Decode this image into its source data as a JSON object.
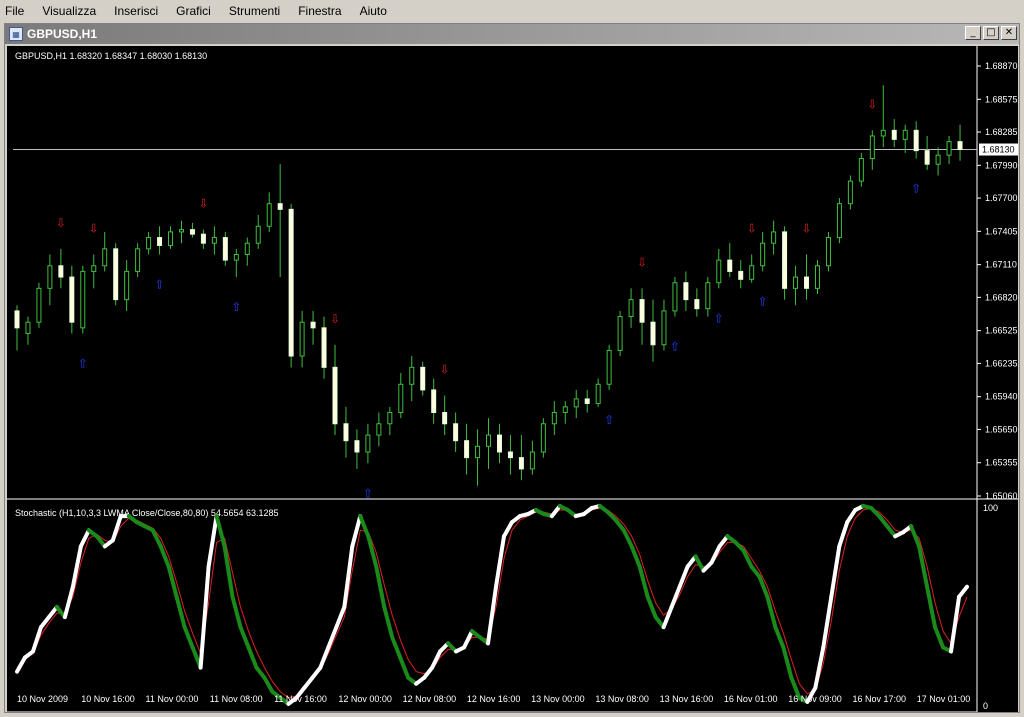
{
  "menu": [
    "File",
    "Visualizza",
    "Inserisci",
    "Grafici",
    "Strumenti",
    "Finestra",
    "Aiuto"
  ],
  "window": {
    "title": "GBPUSD,H1",
    "minimize": "_",
    "maximize": "□",
    "close": "✕"
  },
  "main_chart": {
    "header": "GBPUSD,H1  1.68320 1.68347 1.68030 1.68130",
    "price_levels": [
      "1.68870",
      "1.68575",
      "1.68285",
      "1.67990",
      "1.67700",
      "1.67405",
      "1.67110",
      "1.66820",
      "1.66525",
      "1.66235",
      "1.65940",
      "1.65650",
      "1.65355",
      "1.65060"
    ],
    "current_price": "1.68130"
  },
  "stoch_chart": {
    "header": "Stochastic (H1,10,3,3 LWMA Close/Close,80,80) 54.5654 63.1285",
    "levels": [
      "100",
      "0"
    ]
  },
  "time_labels": [
    "10 Nov 2009",
    "10 Nov 16:00",
    "11 Nov 00:00",
    "11 Nov 08:00",
    "11 Nov 16:00",
    "12 Nov 00:00",
    "12 Nov 08:00",
    "12 Nov 16:00",
    "13 Nov 00:00",
    "13 Nov 08:00",
    "13 Nov 16:00",
    "16 Nov 01:00",
    "16 Nov 09:00",
    "16 Nov 17:00",
    "17 Nov 01:00"
  ],
  "chart_data": [
    {
      "type": "candlestick",
      "title": "GBPUSD,H1",
      "ylim": [
        1.6506,
        1.6887
      ],
      "current_price": 1.6813,
      "candles": [
        [
          1.667,
          1.6675,
          1.6635,
          1.6655
        ],
        [
          1.665,
          1.6665,
          1.664,
          1.666
        ],
        [
          1.666,
          1.6695,
          1.6655,
          1.669
        ],
        [
          1.669,
          1.672,
          1.6675,
          1.671
        ],
        [
          1.671,
          1.6725,
          1.669,
          1.67
        ],
        [
          1.67,
          1.671,
          1.665,
          1.666
        ],
        [
          1.6655,
          1.671,
          1.665,
          1.6705
        ],
        [
          1.6705,
          1.672,
          1.669,
          1.671
        ],
        [
          1.671,
          1.674,
          1.6705,
          1.6725
        ],
        [
          1.6725,
          1.673,
          1.6675,
          1.668
        ],
        [
          1.668,
          1.6715,
          1.667,
          1.6705
        ],
        [
          1.6705,
          1.673,
          1.67,
          1.6725
        ],
        [
          1.6725,
          1.674,
          1.672,
          1.6735
        ],
        [
          1.6735,
          1.6745,
          1.672,
          1.6728
        ],
        [
          1.6728,
          1.6745,
          1.6725,
          1.674
        ],
        [
          1.674,
          1.675,
          1.673,
          1.6742
        ],
        [
          1.6742,
          1.6748,
          1.6735,
          1.6738
        ],
        [
          1.6738,
          1.6742,
          1.6725,
          1.673
        ],
        [
          1.673,
          1.6745,
          1.672,
          1.6735
        ],
        [
          1.6735,
          1.674,
          1.671,
          1.6715
        ],
        [
          1.6715,
          1.6725,
          1.67,
          1.672
        ],
        [
          1.672,
          1.6735,
          1.671,
          1.673
        ],
        [
          1.673,
          1.6755,
          1.6725,
          1.6745
        ],
        [
          1.6745,
          1.6775,
          1.674,
          1.6765
        ],
        [
          1.6765,
          1.68,
          1.67,
          1.676
        ],
        [
          1.676,
          1.6765,
          1.662,
          1.663
        ],
        [
          1.663,
          1.667,
          1.662,
          1.666
        ],
        [
          1.666,
          1.667,
          1.664,
          1.6655
        ],
        [
          1.6655,
          1.6665,
          1.661,
          1.662
        ],
        [
          1.662,
          1.664,
          1.656,
          1.657
        ],
        [
          1.657,
          1.6585,
          1.654,
          1.6555
        ],
        [
          1.6555,
          1.6565,
          1.653,
          1.6545
        ],
        [
          1.6545,
          1.657,
          1.6535,
          1.656
        ],
        [
          1.656,
          1.658,
          1.655,
          1.657
        ],
        [
          1.657,
          1.6585,
          1.656,
          1.658
        ],
        [
          1.658,
          1.6615,
          1.6575,
          1.6605
        ],
        [
          1.6605,
          1.663,
          1.659,
          1.662
        ],
        [
          1.662,
          1.6625,
          1.6595,
          1.66
        ],
        [
          1.66,
          1.661,
          1.657,
          1.658
        ],
        [
          1.658,
          1.6595,
          1.656,
          1.657
        ],
        [
          1.657,
          1.658,
          1.6545,
          1.6555
        ],
        [
          1.6555,
          1.657,
          1.6525,
          1.654
        ],
        [
          1.654,
          1.6565,
          1.6515,
          1.655
        ],
        [
          1.655,
          1.6575,
          1.653,
          1.656
        ],
        [
          1.656,
          1.657,
          1.6535,
          1.6545
        ],
        [
          1.6545,
          1.656,
          1.6525,
          1.654
        ],
        [
          1.654,
          1.656,
          1.652,
          1.653
        ],
        [
          1.653,
          1.6555,
          1.6525,
          1.6545
        ],
        [
          1.6545,
          1.6575,
          1.654,
          1.657
        ],
        [
          1.657,
          1.659,
          1.656,
          1.658
        ],
        [
          1.658,
          1.659,
          1.657,
          1.6585
        ],
        [
          1.6585,
          1.66,
          1.6575,
          1.6592
        ],
        [
          1.6592,
          1.66,
          1.658,
          1.6588
        ],
        [
          1.6588,
          1.661,
          1.6585,
          1.6605
        ],
        [
          1.6605,
          1.664,
          1.66,
          1.6635
        ],
        [
          1.6635,
          1.667,
          1.663,
          1.6665
        ],
        [
          1.6665,
          1.669,
          1.6655,
          1.668
        ],
        [
          1.668,
          1.669,
          1.664,
          1.666
        ],
        [
          1.666,
          1.668,
          1.6625,
          1.664
        ],
        [
          1.664,
          1.668,
          1.6635,
          1.667
        ],
        [
          1.667,
          1.67,
          1.6665,
          1.6695
        ],
        [
          1.6695,
          1.6705,
          1.667,
          1.668
        ],
        [
          1.668,
          1.669,
          1.6665,
          1.6672
        ],
        [
          1.6672,
          1.67,
          1.6665,
          1.6695
        ],
        [
          1.6695,
          1.6725,
          1.669,
          1.6715
        ],
        [
          1.6715,
          1.673,
          1.67,
          1.6705
        ],
        [
          1.6705,
          1.6715,
          1.669,
          1.6698
        ],
        [
          1.6698,
          1.672,
          1.6695,
          1.671
        ],
        [
          1.671,
          1.674,
          1.6705,
          1.673
        ],
        [
          1.673,
          1.675,
          1.672,
          1.674
        ],
        [
          1.674,
          1.6745,
          1.668,
          1.669
        ],
        [
          1.669,
          1.671,
          1.6675,
          1.67
        ],
        [
          1.67,
          1.672,
          1.668,
          1.669
        ],
        [
          1.669,
          1.6715,
          1.6685,
          1.671
        ],
        [
          1.671,
          1.674,
          1.6705,
          1.6735
        ],
        [
          1.6735,
          1.677,
          1.673,
          1.6765
        ],
        [
          1.6765,
          1.679,
          1.676,
          1.6785
        ],
        [
          1.6785,
          1.681,
          1.678,
          1.6805
        ],
        [
          1.6805,
          1.683,
          1.6795,
          1.6825
        ],
        [
          1.6825,
          1.687,
          1.6815,
          1.683
        ],
        [
          1.683,
          1.684,
          1.6815,
          1.6822
        ],
        [
          1.6822,
          1.6835,
          1.681,
          1.683
        ],
        [
          1.683,
          1.6838,
          1.6805,
          1.6812
        ],
        [
          1.6812,
          1.6825,
          1.6795,
          1.68
        ],
        [
          1.68,
          1.6815,
          1.679,
          1.6808
        ],
        [
          1.6808,
          1.6825,
          1.68,
          1.682
        ],
        [
          1.682,
          1.6835,
          1.6803,
          1.6813
        ]
      ]
    },
    {
      "type": "line",
      "title": "Stochastic (H1,10,3,3 LWMA Close/Close,80,80) 54.5654 63.1285",
      "ylim": [
        0,
        100
      ],
      "series": [
        {
          "values": [
            18,
            25,
            28,
            40,
            45,
            50,
            45,
            60,
            80,
            88,
            85,
            80,
            83,
            95,
            95,
            92,
            90,
            88,
            80,
            70,
            55,
            40,
            30,
            20,
            70,
            95,
            80,
            55,
            40,
            30,
            20,
            15,
            8,
            5,
            2,
            5,
            10,
            15,
            20,
            30,
            40,
            50,
            80,
            95,
            85,
            70,
            50,
            35,
            25,
            15,
            12,
            15,
            20,
            28,
            32,
            28,
            30,
            38,
            35,
            32,
            60,
            85,
            92,
            95,
            96,
            98,
            96,
            95,
            100,
            98,
            95,
            96,
            99,
            100,
            97,
            93,
            88,
            80,
            70,
            55,
            45,
            40,
            50,
            60,
            70,
            75,
            68,
            72,
            80,
            85,
            82,
            78,
            70,
            65,
            55,
            40,
            30,
            15,
            5,
            3,
            10,
            30,
            55,
            80,
            92,
            98,
            100,
            99,
            95,
            90,
            85,
            87,
            90,
            80,
            60,
            40,
            30,
            28,
            55,
            60
          ]
        },
        {
          "values": [
            20,
            24,
            27,
            36,
            42,
            47,
            47,
            55,
            72,
            84,
            86,
            83,
            82,
            90,
            94,
            93,
            91,
            89,
            84,
            75,
            62,
            48,
            37,
            27,
            52,
            82,
            84,
            67,
            50,
            38,
            28,
            20,
            13,
            8,
            5,
            6,
            9,
            14,
            19,
            27,
            36,
            45,
            68,
            88,
            87,
            77,
            61,
            46,
            34,
            24,
            18,
            17,
            19,
            25,
            29,
            29,
            30,
            35,
            35,
            34,
            50,
            74,
            88,
            93,
            95,
            97,
            97,
            96,
            98,
            98,
            96,
            96,
            98,
            99,
            98,
            95,
            91,
            85,
            76,
            63,
            52,
            46,
            49,
            56,
            65,
            71,
            70,
            71,
            77,
            82,
            82,
            80,
            74,
            68,
            60,
            48,
            37,
            24,
            12,
            7,
            9,
            22,
            43,
            68,
            85,
            94,
            98,
            99,
            97,
            93,
            88,
            87,
            88,
            84,
            70,
            52,
            38,
            32,
            45,
            55
          ]
        }
      ]
    }
  ]
}
